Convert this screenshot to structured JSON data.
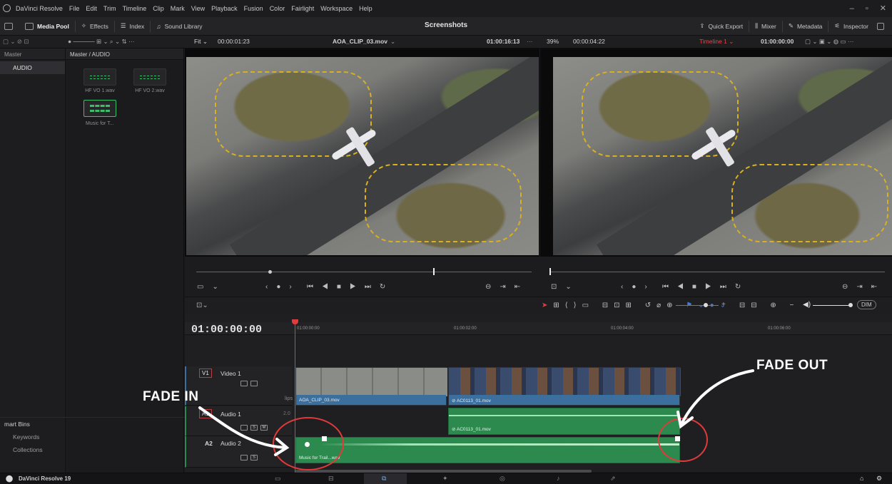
{
  "menubar": {
    "app_name": "DaVinci Resolve",
    "items": [
      "File",
      "Edit",
      "Trim",
      "Timeline",
      "Clip",
      "Mark",
      "View",
      "Playback",
      "Fusion",
      "Color",
      "Fairlight",
      "Workspace",
      "Help"
    ]
  },
  "toolbar": {
    "media_pool": "Media Pool",
    "effects": "Effects",
    "index": "Index",
    "sound_library": "Sound Library",
    "project_title": "Screenshots",
    "quick_export": "Quick Export",
    "mixer": "Mixer",
    "metadata": "Metadata",
    "inspector": "Inspector"
  },
  "subbar": {
    "zoom_fit": "Fit",
    "source_tc": "00:00:01:23",
    "clip_name": "AOA_CLIP_03.mov",
    "source_duration_tc": "01:00:16:13",
    "zoom_pct": "39%",
    "timeline_duration_tc": "00:00:04:22",
    "timeline_name": "Timeline 1",
    "record_tc": "01:00:00:00"
  },
  "bins": {
    "header": "Master",
    "selected": "AUDIO",
    "path": "Master / AUDIO"
  },
  "media_pool": {
    "clips": [
      {
        "name": "HF VO 1.wav"
      },
      {
        "name": "HF VO 2.wav"
      },
      {
        "name": "Music for T..."
      }
    ]
  },
  "smart_bins": {
    "header": "mart Bins",
    "items": [
      "Keywords",
      "Collections"
    ]
  },
  "timeline": {
    "timecode": "01:00:00:00",
    "ruler": [
      "01:00:00:00",
      "01:00:02:00",
      "01:00:04:00",
      "01:00:06:00"
    ],
    "dim_label": "DIM",
    "tracks": [
      {
        "tag": "V1",
        "name": "Video 1"
      },
      {
        "tag": "A1",
        "name": "Audio 1",
        "level": "2.0"
      },
      {
        "tag": "A2",
        "name": "Audio 2"
      }
    ],
    "clips_label": "lips",
    "clips": {
      "v1_a": "AOA_CLIP_03.mov",
      "v1_b": "AC0113_01.mov",
      "a1": "AC0113_01.mov",
      "a2": "Music for Trail...wav"
    }
  },
  "annotations": {
    "fade_in": "FADE IN",
    "fade_out": "FADE OUT",
    "color": "#e03a3a"
  },
  "pagebar": {
    "app_label": "DaVinci Resolve 19"
  }
}
